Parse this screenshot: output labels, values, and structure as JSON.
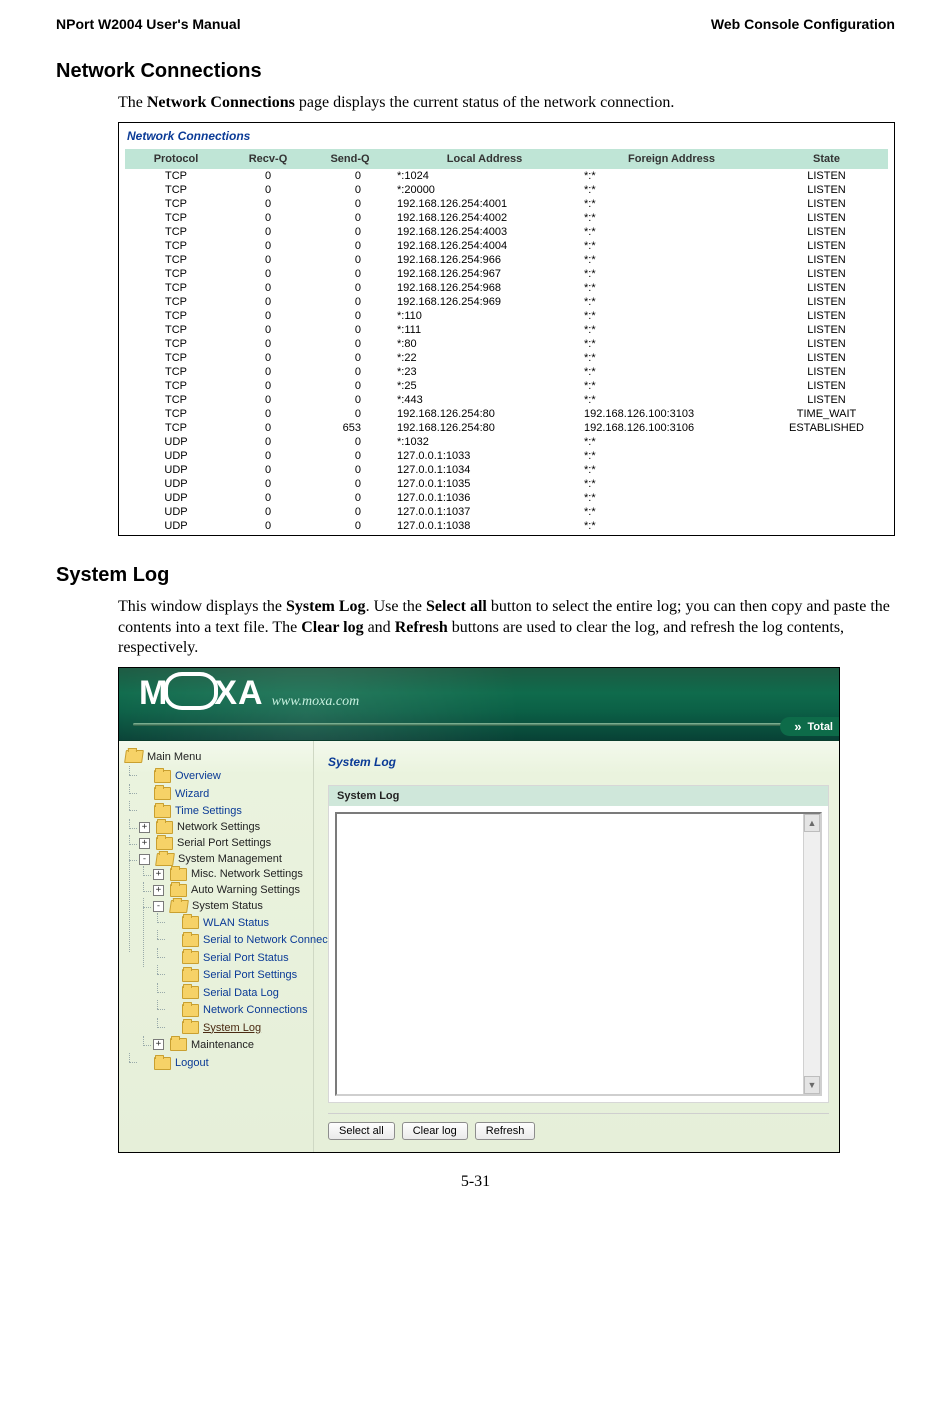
{
  "header": {
    "left": "NPort W2004 User's Manual",
    "right": "Web Console Configuration"
  },
  "page_number": "5-31",
  "section_nc_title": "Network Connections",
  "nc_intro_pre": "The ",
  "nc_intro_bold": "Network Connections",
  "nc_intro_post": " page displays the current status of the network connection.",
  "nc_panel_title": "Network Connections",
  "nc_headers": {
    "proto": "Protocol",
    "recv": "Recv-Q",
    "send": "Send-Q",
    "local": "Local Address",
    "foreign": "Foreign Address",
    "state": "State"
  },
  "nc_rows": [
    {
      "proto": "TCP",
      "recv": "0",
      "send": "0",
      "local": "*:1024",
      "foreign": "*:*",
      "state": "LISTEN"
    },
    {
      "proto": "TCP",
      "recv": "0",
      "send": "0",
      "local": "*:20000",
      "foreign": "*:*",
      "state": "LISTEN"
    },
    {
      "proto": "TCP",
      "recv": "0",
      "send": "0",
      "local": "192.168.126.254:4001",
      "foreign": "*:*",
      "state": "LISTEN"
    },
    {
      "proto": "TCP",
      "recv": "0",
      "send": "0",
      "local": "192.168.126.254:4002",
      "foreign": "*:*",
      "state": "LISTEN"
    },
    {
      "proto": "TCP",
      "recv": "0",
      "send": "0",
      "local": "192.168.126.254:4003",
      "foreign": "*:*",
      "state": "LISTEN"
    },
    {
      "proto": "TCP",
      "recv": "0",
      "send": "0",
      "local": "192.168.126.254:4004",
      "foreign": "*:*",
      "state": "LISTEN"
    },
    {
      "proto": "TCP",
      "recv": "0",
      "send": "0",
      "local": "192.168.126.254:966",
      "foreign": "*:*",
      "state": "LISTEN"
    },
    {
      "proto": "TCP",
      "recv": "0",
      "send": "0",
      "local": "192.168.126.254:967",
      "foreign": "*:*",
      "state": "LISTEN"
    },
    {
      "proto": "TCP",
      "recv": "0",
      "send": "0",
      "local": "192.168.126.254:968",
      "foreign": "*:*",
      "state": "LISTEN"
    },
    {
      "proto": "TCP",
      "recv": "0",
      "send": "0",
      "local": "192.168.126.254:969",
      "foreign": "*:*",
      "state": "LISTEN"
    },
    {
      "proto": "TCP",
      "recv": "0",
      "send": "0",
      "local": "*:110",
      "foreign": "*:*",
      "state": "LISTEN"
    },
    {
      "proto": "TCP",
      "recv": "0",
      "send": "0",
      "local": "*:111",
      "foreign": "*:*",
      "state": "LISTEN"
    },
    {
      "proto": "TCP",
      "recv": "0",
      "send": "0",
      "local": "*:80",
      "foreign": "*:*",
      "state": "LISTEN"
    },
    {
      "proto": "TCP",
      "recv": "0",
      "send": "0",
      "local": "*:22",
      "foreign": "*:*",
      "state": "LISTEN"
    },
    {
      "proto": "TCP",
      "recv": "0",
      "send": "0",
      "local": "*:23",
      "foreign": "*:*",
      "state": "LISTEN"
    },
    {
      "proto": "TCP",
      "recv": "0",
      "send": "0",
      "local": "*:25",
      "foreign": "*:*",
      "state": "LISTEN"
    },
    {
      "proto": "TCP",
      "recv": "0",
      "send": "0",
      "local": "*:443",
      "foreign": "*:*",
      "state": "LISTEN"
    },
    {
      "proto": "TCP",
      "recv": "0",
      "send": "0",
      "local": "192.168.126.254:80",
      "foreign": "192.168.126.100:3103",
      "state": "TIME_WAIT"
    },
    {
      "proto": "TCP",
      "recv": "0",
      "send": "653",
      "local": "192.168.126.254:80",
      "foreign": "192.168.126.100:3106",
      "state": "ESTABLISHED"
    },
    {
      "proto": "UDP",
      "recv": "0",
      "send": "0",
      "local": "*:1032",
      "foreign": "*:*",
      "state": ""
    },
    {
      "proto": "UDP",
      "recv": "0",
      "send": "0",
      "local": "127.0.0.1:1033",
      "foreign": "*:*",
      "state": ""
    },
    {
      "proto": "UDP",
      "recv": "0",
      "send": "0",
      "local": "127.0.0.1:1034",
      "foreign": "*:*",
      "state": ""
    },
    {
      "proto": "UDP",
      "recv": "0",
      "send": "0",
      "local": "127.0.0.1:1035",
      "foreign": "*:*",
      "state": ""
    },
    {
      "proto": "UDP",
      "recv": "0",
      "send": "0",
      "local": "127.0.0.1:1036",
      "foreign": "*:*",
      "state": ""
    },
    {
      "proto": "UDP",
      "recv": "0",
      "send": "0",
      "local": "127.0.0.1:1037",
      "foreign": "*:*",
      "state": ""
    },
    {
      "proto": "UDP",
      "recv": "0",
      "send": "0",
      "local": "127.0.0.1:1038",
      "foreign": "*:*",
      "state": ""
    }
  ],
  "section_sl_title": "System Log",
  "sl_para_parts": {
    "t0": "This window displays the ",
    "b0": "System Log",
    "t1": ". Use the ",
    "b1": "Select all",
    "t2": " button to select the entire log; you can then copy and paste the contents into a text file. The ",
    "b2": "Clear log",
    "t3": " and ",
    "b3": "Refresh",
    "t4": " buttons are used to clear the log, and refresh the log contents, respectively."
  },
  "moxa": {
    "url": "www.moxa.com",
    "right_pill": "Total",
    "page_title": "System Log",
    "band": "System Log",
    "buttons": {
      "select_all": "Select all",
      "clear_log": "Clear log",
      "refresh": "Refresh"
    }
  },
  "tree": {
    "main": "Main Menu",
    "overview": "Overview",
    "wizard": "Wizard",
    "time": "Time Settings",
    "net": "Network Settings",
    "serial": "Serial Port Settings",
    "sysmgmt": "System Management",
    "misc": "Misc. Network Settings",
    "autowarn": "Auto Warning Settings",
    "sysstatus": "System Status",
    "wlan": "WLAN Status",
    "s2n": "Serial to Network Connec",
    "sps": "Serial Port Status",
    "spset": "Serial Port Settings",
    "sdl": "Serial Data Log",
    "nc": "Network Connections",
    "slog": "System Log",
    "maint": "Maintenance",
    "logout": "Logout"
  },
  "exp": {
    "plus": "+",
    "minus": "-"
  }
}
